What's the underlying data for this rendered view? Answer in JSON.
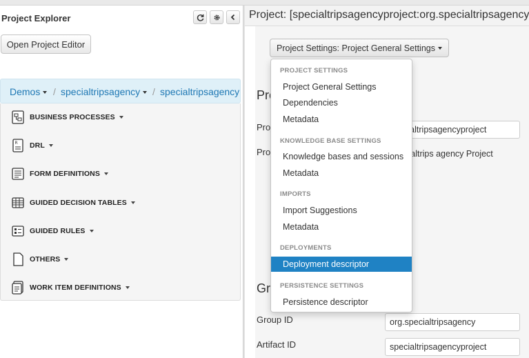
{
  "left_panel": {
    "title": "Project Explorer",
    "toolbar": {
      "refresh_icon": "refresh-icon",
      "settings_icon": "gear-icon",
      "collapse_icon": "chevron-left-icon"
    },
    "open_editor_label": "Open Project Editor",
    "breadcrumb": {
      "items": [
        "Demos",
        "specialtripsagency",
        "specialtripsagencyp"
      ],
      "separator": "/"
    },
    "resources": [
      {
        "label": "BUSINESS PROCESSES",
        "icon": "business-process-icon"
      },
      {
        "label": "DRL",
        "icon": "drl-file-icon"
      },
      {
        "label": "FORM DEFINITIONS",
        "icon": "form-icon"
      },
      {
        "label": "GUIDED DECISION TABLES",
        "icon": "decision-table-icon"
      },
      {
        "label": "GUIDED RULES",
        "icon": "guided-rule-icon"
      },
      {
        "label": "OTHERS",
        "icon": "file-icon"
      },
      {
        "label": "WORK ITEM DEFINITIONS",
        "icon": "work-item-icon"
      }
    ]
  },
  "right_panel": {
    "title": "Project: [specialtripsagencyproject:org.specialtripsagency",
    "settings_button_label": "Project Settings: Project General Settings",
    "section_project_heading": "Pro",
    "fields_top": [
      {
        "label": "Proj",
        "value": "specialtripsagencyproject"
      },
      {
        "label": "Proj",
        "value": "Specialtrips agency Project"
      }
    ],
    "section_group_heading": "Gr",
    "fields_bottom": [
      {
        "label": "Group ID",
        "value": "org.specialtripsagency"
      },
      {
        "label": "Artifact ID",
        "value": "specialtripsagencyproject"
      }
    ]
  },
  "dropdown": {
    "groups": [
      {
        "header": "PROJECT SETTINGS",
        "items": [
          "Project General Settings",
          "Dependencies",
          "Metadata"
        ]
      },
      {
        "header": "KNOWLEDGE BASE SETTINGS",
        "items": [
          "Knowledge bases and sessions",
          "Metadata"
        ]
      },
      {
        "header": "IMPORTS",
        "items": [
          "Import Suggestions",
          "Metadata"
        ]
      },
      {
        "header": "DEPLOYMENTS",
        "items": [
          "Deployment descriptor"
        ]
      },
      {
        "header": "PERSISTENCE SETTINGS",
        "items": [
          "Persistence descriptor"
        ]
      }
    ],
    "active_item": "Deployment descriptor"
  },
  "colors": {
    "accent": "#1f82c4",
    "breadcrumb_bg": "#dff0f8",
    "link": "#1f78b4"
  }
}
